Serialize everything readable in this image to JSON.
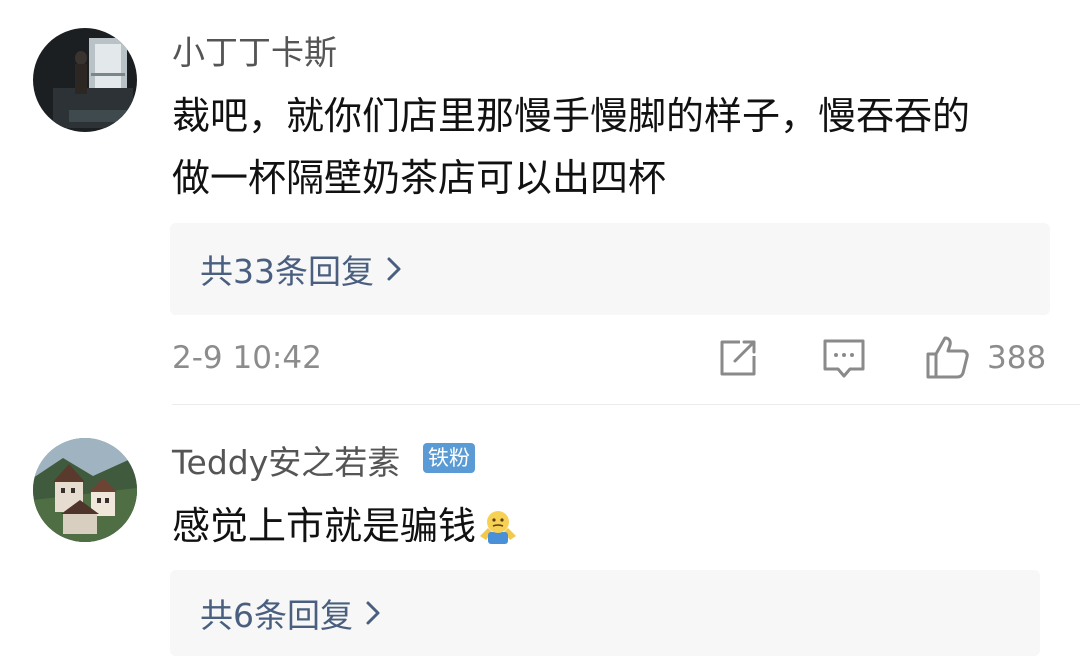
{
  "comments": [
    {
      "username": "小丁丁卡斯",
      "text_lines": [
        "裁吧，就你们店里那慢手慢脚的样子，慢吞吞的",
        "做一杯隔壁奶茶店可以出四杯"
      ],
      "replies_label": "共33条回复",
      "timestamp": "2-9 10:42",
      "like_count": "388",
      "avatar": "avatar-silhouette-window"
    },
    {
      "username": "Teddy安之若素",
      "badge": "铁粉",
      "text": "感觉上市就是骗钱",
      "emoji": "shrug-emoji",
      "replies_label": "共6条回复",
      "avatar": "avatar-village-landscape"
    }
  ],
  "icons": {
    "share": "share-icon",
    "comment": "comment-icon",
    "like": "like-icon",
    "chevron": "chevron-right-icon"
  },
  "colors": {
    "reply_text": "#4a5f7f",
    "reply_bg": "#f7f7f7",
    "meta": "#8c8c8c",
    "badge": "#5b9bd5"
  }
}
